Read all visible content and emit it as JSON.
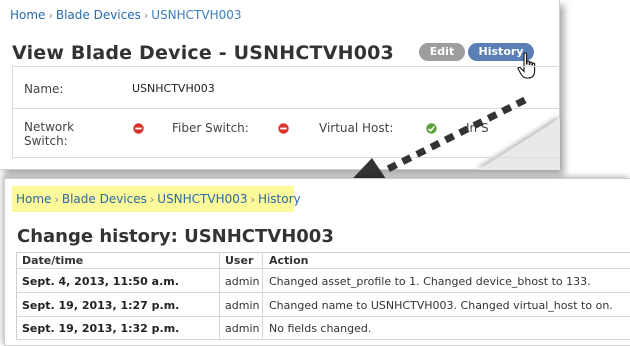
{
  "top": {
    "breadcrumb": [
      "Home",
      "Blade Devices",
      "USNHCTVH003"
    ],
    "title": "View Blade Device - USNHCTVH003",
    "edit_label": "Edit",
    "history_label": "History",
    "name_label": "Name:",
    "name_value": "USNHCTVH003",
    "network_switch_label": "Network Switch:",
    "fiber_switch_label": "Fiber Switch:",
    "virtual_host_label": "Virtual Host:",
    "in_service_label": "In S",
    "status_colors": {
      "no": "#d9312b",
      "yes": "#5aa13a"
    }
  },
  "bottom": {
    "breadcrumb": [
      "Home",
      "Blade Devices",
      "USNHCTVH003",
      "History"
    ],
    "title": "Change history: USNHCTVH003",
    "columns": [
      "Date/time",
      "User",
      "Action"
    ],
    "rows": [
      {
        "date": "Sept. 4, 2013, 11:50 a.m.",
        "user": "admin",
        "action": "Changed asset_profile to 1. Changed device_bhost to 133."
      },
      {
        "date": "Sept. 19, 2013, 1:27 p.m.",
        "user": "admin",
        "action": "Changed name to USNHCTVH003. Changed virtual_host to on."
      },
      {
        "date": "Sept. 19, 2013, 1:32 p.m.",
        "user": "admin",
        "action": "No fields changed."
      }
    ]
  }
}
